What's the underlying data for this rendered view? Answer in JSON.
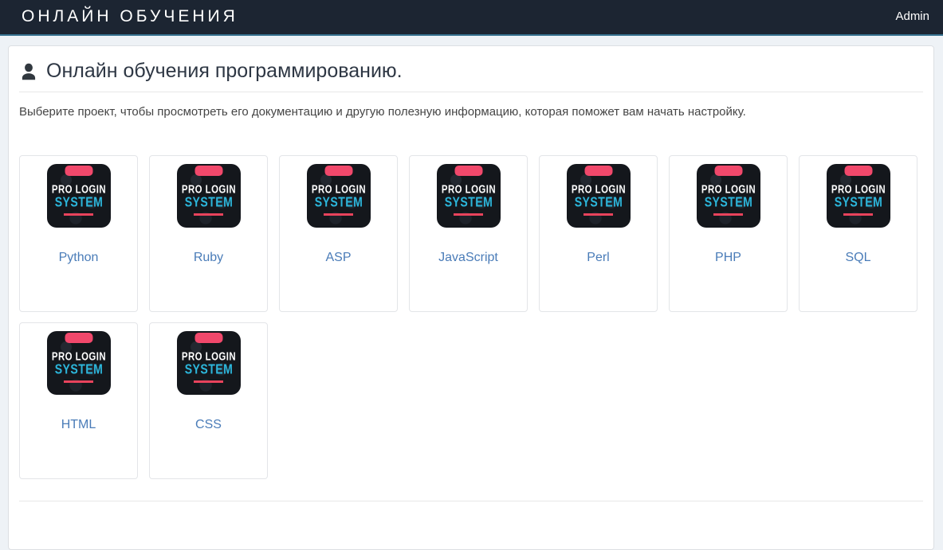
{
  "navbar": {
    "brand": "ОНЛАЙН ОБУЧЕНИЯ",
    "admin_label": "Admin"
  },
  "main": {
    "title": "Онлайн обучения программированию.",
    "intro": "Выберите проект, чтобы просмотреть его документацию и другую полезную информацию, которая поможет вам начать настройку."
  },
  "card_logo": {
    "line1": "PRO LOGIN",
    "line2": "SYSTEM"
  },
  "courses": [
    "Python",
    "Ruby",
    "ASP",
    "JavaScript",
    "Perl",
    "PHP",
    "SQL",
    "HTML",
    "CSS"
  ],
  "colors": {
    "navbar_bg": "#1c2532",
    "navbar_border": "#35718f",
    "page_bg": "#eef2f6",
    "panel_border": "#dcdfe3",
    "link": "#4a7cb8",
    "logo_bg": "#14171c",
    "logo_tab": "#f1486b",
    "logo_cyan": "#2cb6db",
    "logo_underline": "#e8435c",
    "title_text": "#2e3744"
  }
}
